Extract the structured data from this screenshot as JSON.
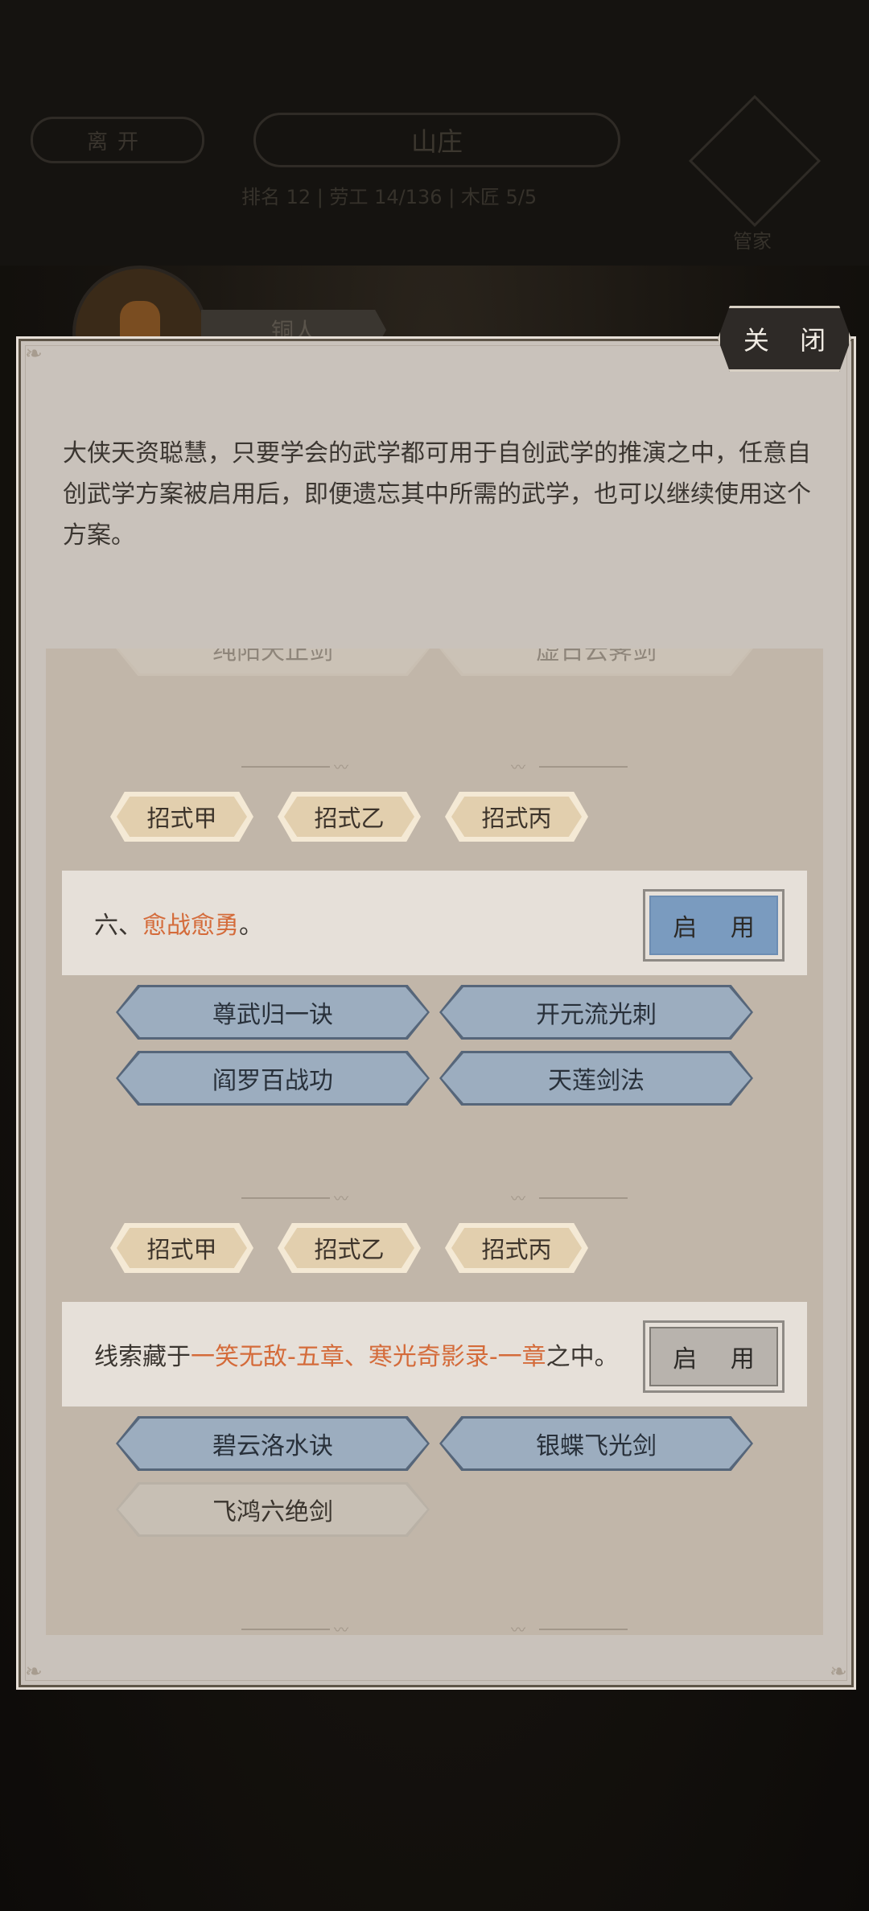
{
  "background": {
    "leave_label": "离开",
    "title": "山庄",
    "stats": "排名 12  |  劳工 14/136  |  木匠 5/5",
    "butler_label": "管家",
    "character_tag": "铜人"
  },
  "modal": {
    "close_label": "关 闭",
    "description": "大侠天资聪慧，只要学会的武学都可用于自创武学的推演之中，任意自创武学方案被启用后，即便遗忘其中所需的武学，也可以继续使用这个方案。",
    "partial_skills": [
      "纯阳天正剑",
      "虚日云霁剑"
    ],
    "schemes": [
      {
        "moves": [
          "招式甲",
          "招式乙",
          "招式丙"
        ]
      },
      {
        "prefix": "六、",
        "highlight": "愈战愈勇",
        "suffix": "。",
        "enable_label": "启 用",
        "enable_state": "active",
        "skills": [
          "尊武归一诀",
          "开元流光刺",
          "阎罗百战功",
          "天莲剑法"
        ],
        "moves": [
          "招式甲",
          "招式乙",
          "招式丙"
        ]
      },
      {
        "prefix": "线索藏于",
        "highlight": "一笑无敌-五章、寒光奇影录-一章",
        "suffix": "之中。",
        "enable_label": "启 用",
        "enable_state": "disabled",
        "skills": [
          "碧云洛水诀",
          "银蝶飞光剑",
          "飞鸿六绝剑"
        ]
      }
    ]
  },
  "colors": {
    "highlight": "#d46b3a",
    "enable_active": "#7a9bbf",
    "skill_blue": "#9cadbf",
    "modal_bg": "#c9c2bb"
  }
}
